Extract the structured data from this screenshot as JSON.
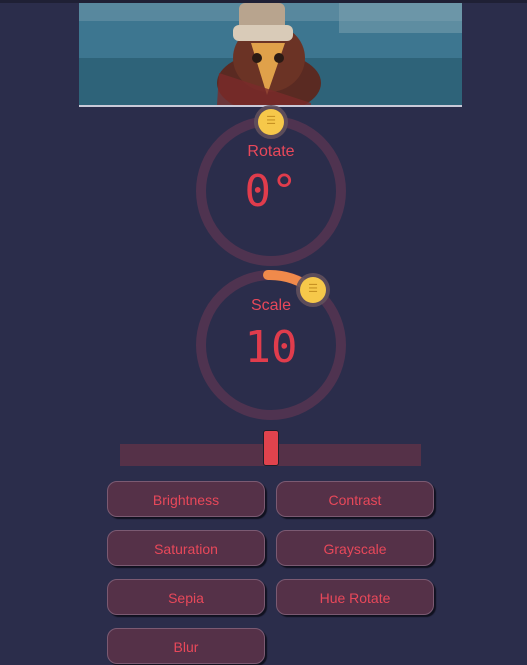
{
  "rotate": {
    "label": "Rotate",
    "value": "0°",
    "knob_icon": "menu-lines-icon"
  },
  "scale": {
    "label": "Scale",
    "value": "10",
    "knob_icon": "menu-lines-icon"
  },
  "slider": {
    "level": 0.5
  },
  "filters": [
    "Brightness",
    "Contrast",
    "Saturation",
    "Grayscale",
    "Sepia",
    "Hue Rotate",
    "Blur"
  ],
  "colors": {
    "background": "#2b2d4b",
    "ring": "#4f3350",
    "accent_text": "#e8485a",
    "knob": "#f6c84a",
    "arc": "#f08a4b",
    "button_bg": "#553148"
  }
}
